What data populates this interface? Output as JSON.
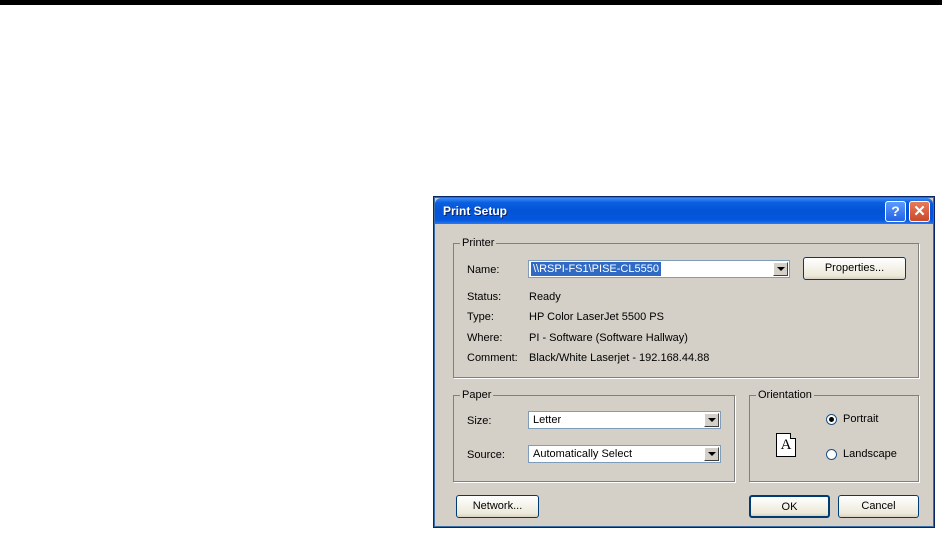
{
  "dialog": {
    "title": "Print Setup",
    "help_button": "?",
    "close_button": "✕"
  },
  "printer": {
    "group_label": "Printer",
    "name_label": "Name:",
    "name_value": "\\\\RSPI-FS1\\PISE-CL5550",
    "properties_button": "Properties...",
    "status_label": "Status:",
    "status_value": "Ready",
    "type_label": "Type:",
    "type_value": "HP Color LaserJet 5500 PS",
    "where_label": "Where:",
    "where_value": "PI - Software (Software Hallway)",
    "comment_label": "Comment:",
    "comment_value": "Black/White Laserjet - 192.168.44.88"
  },
  "paper": {
    "group_label": "Paper",
    "size_label": "Size:",
    "size_value": "Letter",
    "source_label": "Source:",
    "source_value": "Automatically Select"
  },
  "orientation": {
    "group_label": "Orientation",
    "icon_letter": "A",
    "portrait_label": "Portrait",
    "landscape_label": "Landscape",
    "selected": "Portrait"
  },
  "buttons": {
    "network": "Network...",
    "ok": "OK",
    "cancel": "Cancel"
  }
}
